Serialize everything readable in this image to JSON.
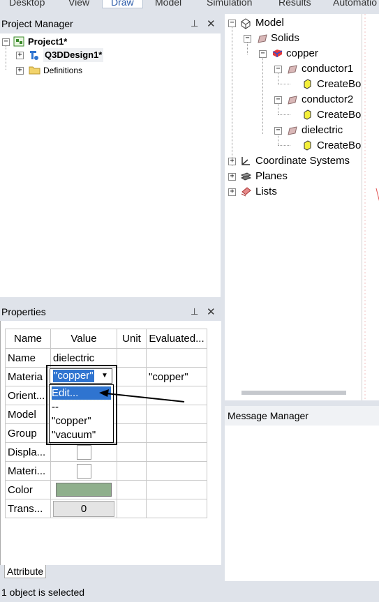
{
  "menubar": {
    "items": [
      "Desktop",
      "View",
      "Draw",
      "Model",
      "Simulation",
      "Results",
      "Automatio"
    ],
    "active": "Draw"
  },
  "project_manager": {
    "title": "Project Manager",
    "pin_icon": "pin-icon",
    "close_icon": "close-icon",
    "project": "Project1*",
    "design": "Q3DDesign1*",
    "definitions": "Definitions"
  },
  "model_tree": {
    "model": "Model",
    "solids": "Solids",
    "copper": "copper",
    "conductor1": "conductor1",
    "conductor2": "conductor2",
    "dielectric": "dielectric",
    "create_box": "CreateBo",
    "coordinate_systems": "Coordinate Systems",
    "planes": "Planes",
    "lists": "Lists"
  },
  "properties": {
    "title": "Properties",
    "headers": [
      "Name",
      "Value",
      "Unit",
      "Evaluated..."
    ],
    "rows": [
      {
        "name": "Name",
        "value": "dielectric"
      },
      {
        "name": "Materia",
        "value": "\"copper\"",
        "evaluated": "\"copper\""
      },
      {
        "name": "Orient..."
      },
      {
        "name": "Model"
      },
      {
        "name": "Group"
      },
      {
        "name": "Displa..."
      },
      {
        "name": "Materi..."
      },
      {
        "name": "Color",
        "color": "#8faf8c"
      },
      {
        "name": "Trans...",
        "value": "0"
      }
    ],
    "dropdown_options": [
      "Edit...",
      "--",
      "\"copper\"",
      "\"vacuum\""
    ],
    "highlighted_option": "Edit...",
    "tab": "Attribute"
  },
  "message_manager": {
    "title": "Message Manager"
  },
  "status": {
    "text": "1 object is selected"
  }
}
